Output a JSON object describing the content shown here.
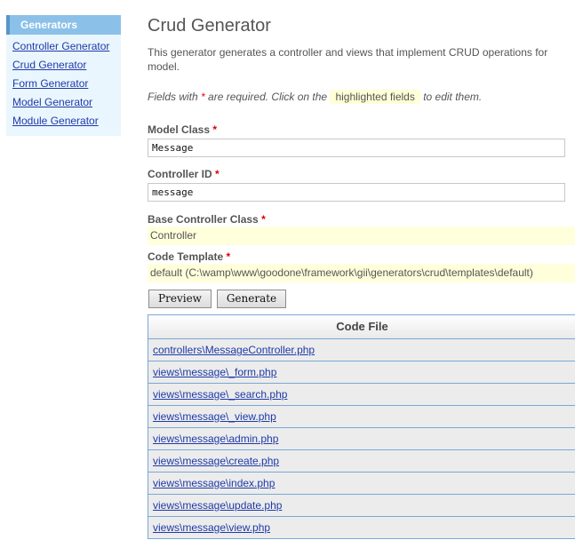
{
  "sidebar": {
    "header": "Generators",
    "items": [
      {
        "label": "Controller Generator"
      },
      {
        "label": "Crud Generator"
      },
      {
        "label": "Form Generator"
      },
      {
        "label": "Model Generator"
      },
      {
        "label": "Module Generator"
      }
    ]
  },
  "main": {
    "title": "Crud Generator",
    "description_line1": "This generator generates a controller and views that implement CRUD operations for",
    "description_line2": "model.",
    "note_prefix": "Fields with ",
    "note_star": "*",
    "note_middle": " are required. Click on the ",
    "note_highlight": "highlighted fields",
    "note_suffix": " to edit them."
  },
  "form": {
    "model_class": {
      "label": "Model Class",
      "value": "Message"
    },
    "controller_id": {
      "label": "Controller ID",
      "value": "message"
    },
    "base_controller_class": {
      "label": "Base Controller Class",
      "value": "Controller"
    },
    "code_template": {
      "label": "Code Template",
      "value": "default (C:\\wamp\\www\\goodone\\framework\\gii\\generators\\crud\\templates\\default)"
    },
    "required_mark": "*",
    "preview_label": "Preview",
    "generate_label": "Generate"
  },
  "table": {
    "header": "Code File",
    "rows": [
      "controllers\\MessageController.php",
      "views\\message\\_form.php",
      "views\\message\\_search.php",
      "views\\message\\_view.php",
      "views\\message\\admin.php",
      "views\\message\\create.php",
      "views\\message\\index.php",
      "views\\message\\update.php",
      "views\\message\\view.php"
    ]
  }
}
